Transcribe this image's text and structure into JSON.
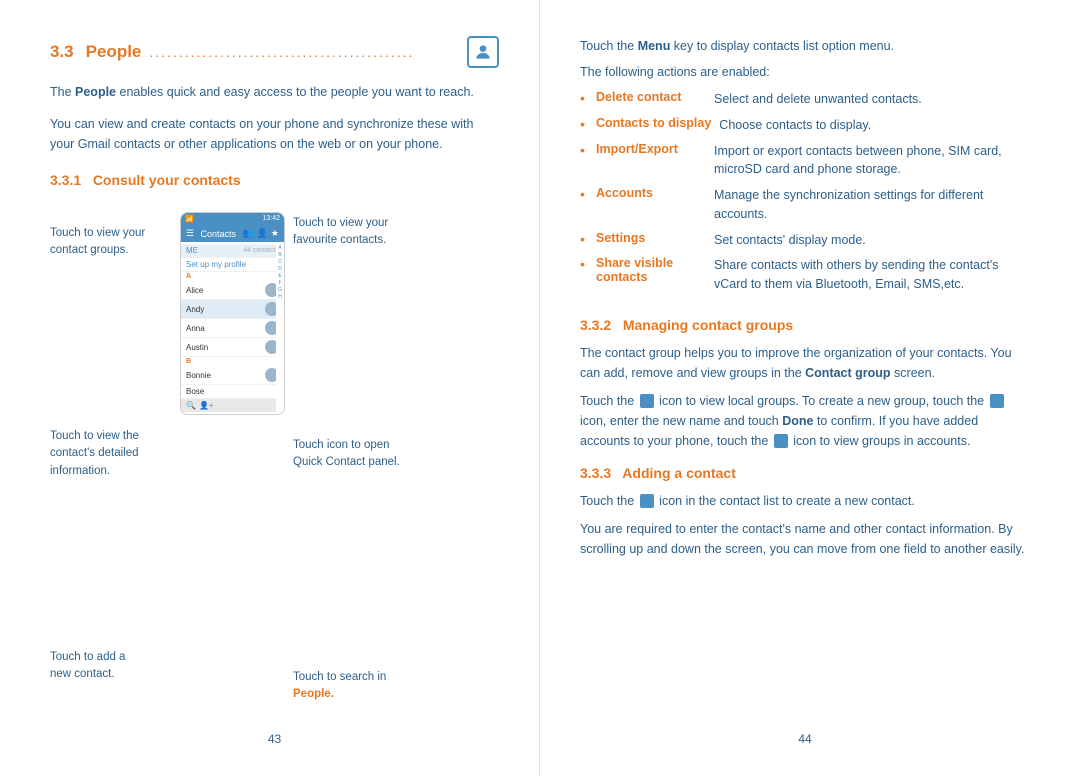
{
  "left_page": {
    "section_number": "3.3",
    "section_title": "People",
    "section_dots": ".............................................",
    "page_number": "43",
    "intro_text_1": "The People enables quick and easy access to the people you want to reach.",
    "intro_bold_1": "People",
    "intro_text_2": "You can view and create contacts on your phone and synchronize these with your Gmail contacts or other applications on the web or on your phone.",
    "subsection_number": "3.3.1",
    "subsection_title": "Consult your contacts",
    "labels": {
      "left": [
        {
          "id": "view-groups",
          "text": "Touch to view your contact groups."
        },
        {
          "id": "view-detail",
          "text": "Touch to view the contact's detailed information."
        },
        {
          "id": "add-contact",
          "text": "Touch to add a new contact."
        }
      ],
      "right": [
        {
          "id": "view-fav",
          "text": "Touch to view your favourite contacts."
        },
        {
          "id": "open-panel",
          "text": "Touch icon to open Quick Contact panel."
        },
        {
          "id": "search",
          "text": "Touch to search in <strong>People.</strong>"
        }
      ]
    },
    "phone_contacts": [
      "ME",
      "Set up my profile",
      "A",
      "Alice",
      "Andy",
      "Anna",
      "Austin",
      "B",
      "Bonnie",
      "Bose"
    ]
  },
  "right_page": {
    "page_number": "44",
    "menu_intro": "Touch the Menu key to display contacts list option menu.",
    "menu_bold": "Menu",
    "actions_intro": "The following actions are enabled:",
    "actions": [
      {
        "label": "Delete contact",
        "desc": "Select and delete unwanted contacts."
      },
      {
        "label": "Contacts to display",
        "desc": "Choose contacts to display."
      },
      {
        "label": "Import/Export",
        "desc": "Import or export contacts between phone, SIM card, microSD card and phone storage."
      },
      {
        "label": "Accounts",
        "desc": "Manage the synchronization settings for different accounts."
      },
      {
        "label": "Settings",
        "desc": "Set contacts' display mode."
      },
      {
        "label": "Share visible contacts",
        "desc": "Share contacts with others by sending the contact's vCard to them via Bluetooth, Email, SMS,etc."
      }
    ],
    "section_332_number": "3.3.2",
    "section_332_title": "Managing contact groups",
    "section_332_body_1": "The contact group helps you to improve the organization of your contacts. You can add, remove and view groups in the Contact group screen.",
    "section_332_bold_1": "Contact group",
    "section_332_body_2": "Touch the  icon to view local groups. To create a new group, touch the  icon, enter the new name and touch Done to confirm. If you have added accounts to your phone, touch the  icon to view groups in accounts.",
    "section_332_bold_2": "Done",
    "section_333_number": "3.3.3",
    "section_333_title": "Adding a contact",
    "section_333_body_1": "Touch the  icon in the contact list to create a new contact.",
    "section_333_body_2": "You are required to enter the contact's name and other contact information. By scrolling up and down the screen, you can move from one field to another easily."
  }
}
